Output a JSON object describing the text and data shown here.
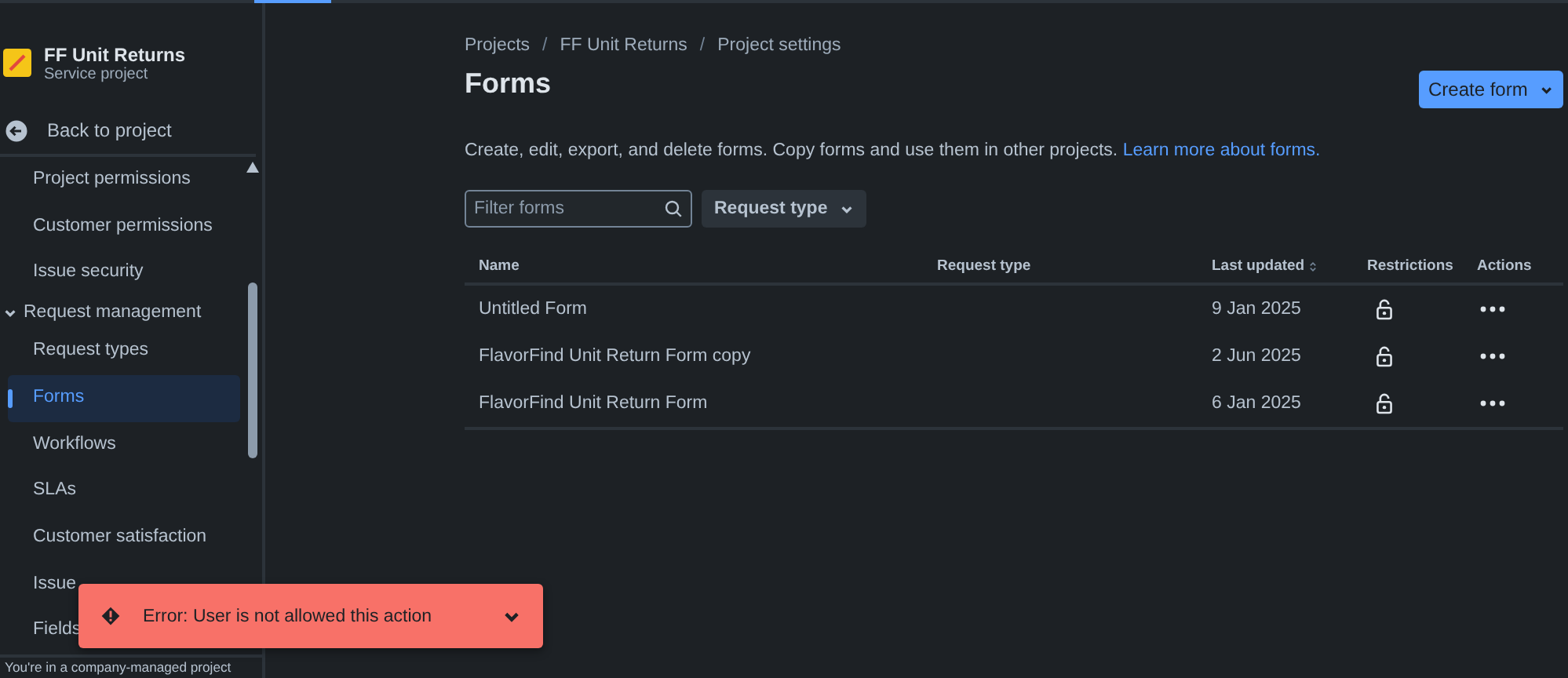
{
  "project": {
    "name": "FF Unit Returns",
    "type": "Service project"
  },
  "back_link": "Back to project",
  "sidebar": {
    "items": [
      {
        "kind": "item",
        "label": "Project permissions",
        "selected": false
      },
      {
        "kind": "item",
        "label": "Customer permissions",
        "selected": false
      },
      {
        "kind": "item",
        "label": "Issue security",
        "selected": false
      },
      {
        "kind": "section",
        "label": "Request management",
        "expanded": true
      },
      {
        "kind": "item",
        "label": "Request types",
        "selected": false
      },
      {
        "kind": "item",
        "label": "Forms",
        "selected": true
      },
      {
        "kind": "item",
        "label": "Workflows",
        "selected": false
      },
      {
        "kind": "item",
        "label": "SLAs",
        "selected": false
      },
      {
        "kind": "item",
        "label": "Customer satisfaction",
        "selected": false
      },
      {
        "kind": "item",
        "label": "Issue",
        "selected": false
      },
      {
        "kind": "item",
        "label": "Fields",
        "selected": false
      }
    ],
    "footer": "You're in a company-managed project"
  },
  "breadcrumbs": [
    {
      "kind": "link",
      "text": "Projects"
    },
    {
      "kind": "separator",
      "text": "/"
    },
    {
      "kind": "link",
      "text": "FF Unit Returns"
    },
    {
      "kind": "separator",
      "text": "/"
    },
    {
      "kind": "link",
      "text": "Project settings"
    }
  ],
  "title": "Forms",
  "create_button": "Create form",
  "description": {
    "text": "Create, edit, export, and delete forms. Copy forms and use them in other projects.",
    "link": "Learn more about forms."
  },
  "filter": {
    "placeholder": "Filter forms"
  },
  "request_type_filter": "Request type",
  "table": {
    "columns": [
      {
        "label": "Name",
        "sortable": false
      },
      {
        "label": "Request type",
        "sortable": false
      },
      {
        "label": "Last updated",
        "sortable": true
      },
      {
        "label": "Restrictions",
        "sortable": false
      },
      {
        "label": "Actions",
        "sortable": false
      }
    ],
    "rows": [
      {
        "name": "Untitled Form",
        "updated": "9 Jan 2025",
        "restricted": false
      },
      {
        "name": "FlavorFind Unit Return Form copy",
        "updated": "2 Jun 2025",
        "restricted": false
      },
      {
        "name": "FlavorFind Unit Return Form",
        "updated": "6 Jan 2025",
        "restricted": false
      }
    ]
  },
  "toast": {
    "kind": "error",
    "message": "Error: User is not allowed this action"
  }
}
